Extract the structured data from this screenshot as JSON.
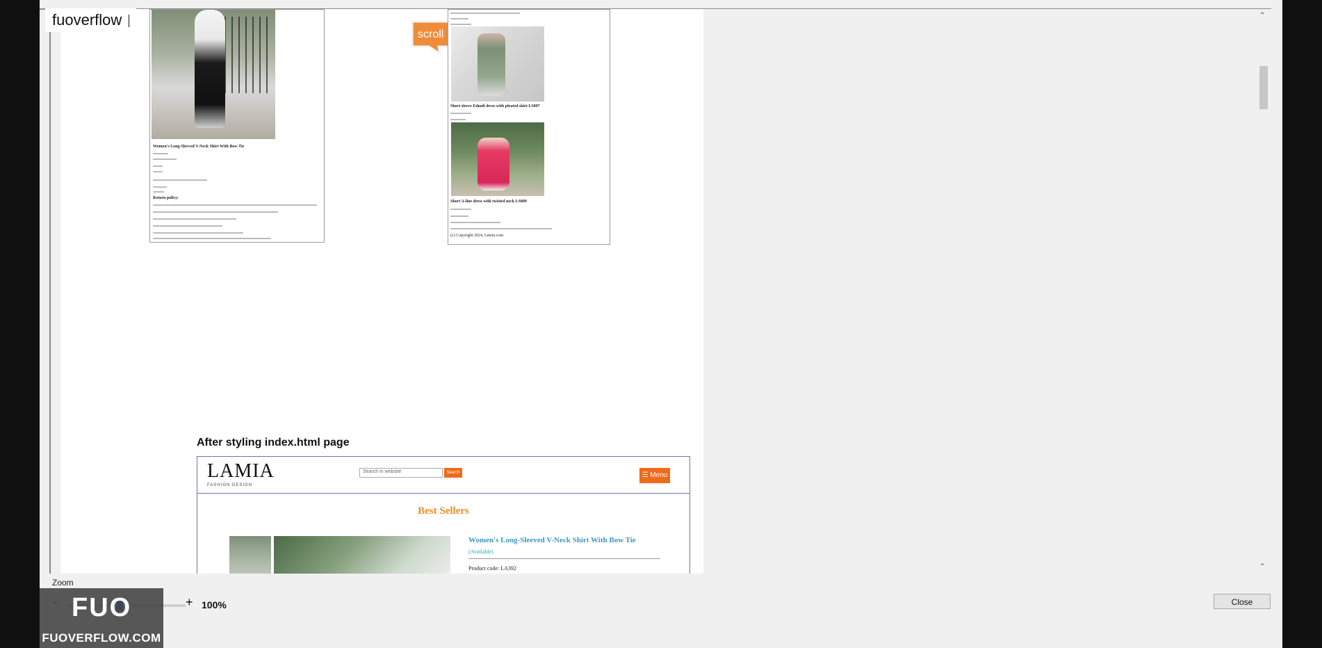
{
  "watermark": {
    "title": "fuoverflow"
  },
  "callout": {
    "label": "scroll"
  },
  "left_shot": {
    "product_title": "Women's Long-Sleeved V-Neck Shirt With Bow Tie",
    "policy_heading": "Return policy:"
  },
  "right_shot": {
    "item1_title": "Short sleeve Eduuli dress with pleated skirt LS097",
    "item2_title": "Short A-line dress with twisted neck LS089",
    "copyright": "(c) Copyright 2024, Lamia.com"
  },
  "section": {
    "title": "After styling index.html page"
  },
  "lamia": {
    "logo": "LAMIA",
    "logo_sub": "FASHION DESIGN",
    "search_placeholder": "Search in website",
    "search_button": "Search",
    "menu_button": "☰ Menu",
    "best_sellers": "Best Sellers",
    "product_title": "Women's Long-Sleeved V-Neck Shirt With Bow Tie",
    "availability": "(Available)",
    "product_code": "Product code: LA392"
  },
  "toolbar": {
    "zoom_label": "Zoom",
    "zoom_minus": "-",
    "zoom_plus": "+",
    "zoom_value": "100%",
    "zoom_level": 1.0,
    "close_label": "Close"
  },
  "badge": {
    "logo": "FUO",
    "url": "FUOVERFLOW.COM"
  },
  "colors": {
    "accent_orange": "#ef6a1a",
    "title_blue": "#3b97c8",
    "available_teal": "#1fa8a8"
  }
}
